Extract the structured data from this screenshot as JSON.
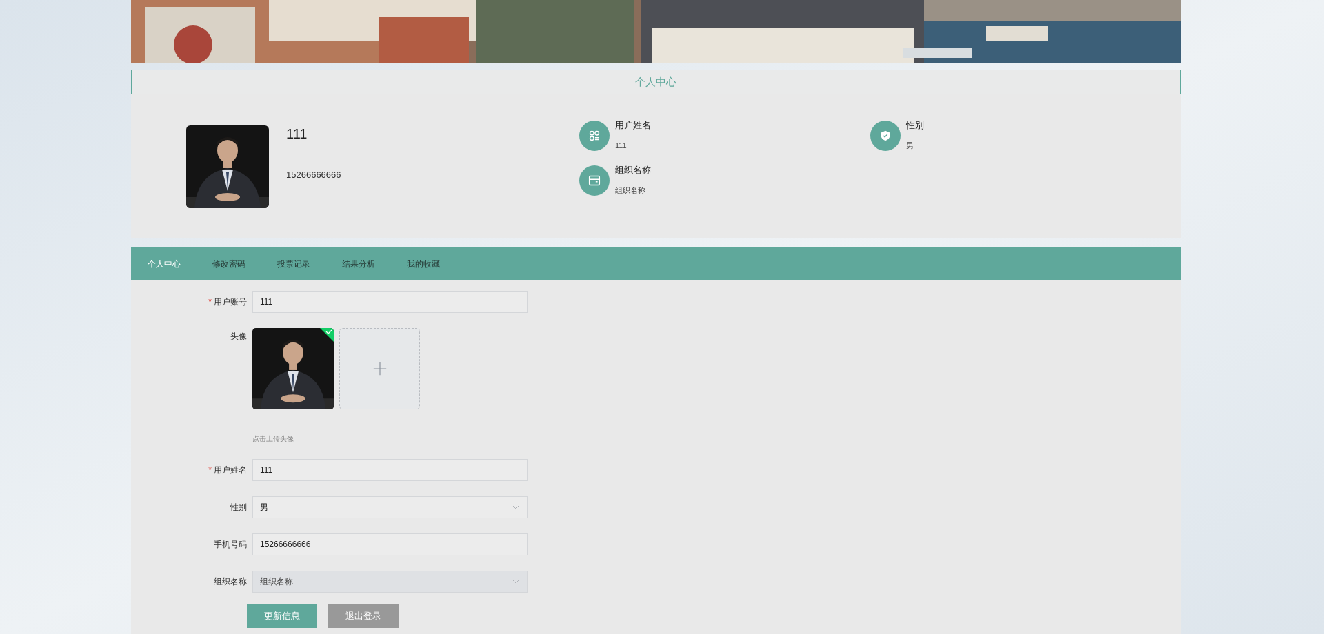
{
  "title": "个人中心",
  "profile": {
    "name": "111",
    "phone": "15266666666",
    "info_columns": [
      [
        {
          "label": "用户姓名",
          "value": "111"
        },
        {
          "label": "组织名称",
          "value": "组织名称"
        }
      ],
      [
        {
          "label": "性别",
          "value": "男"
        }
      ]
    ]
  },
  "tabs": [
    {
      "label": "个人中心",
      "selected": true
    },
    {
      "label": "修改密码",
      "selected": false
    },
    {
      "label": "投票记录",
      "selected": false
    },
    {
      "label": "结果分析",
      "selected": false
    },
    {
      "label": "我的收藏",
      "selected": false
    }
  ],
  "form": {
    "fields": [
      {
        "kind": "text",
        "required_mark": "*",
        "label": "用户账号",
        "value": "111"
      },
      {
        "kind": "avatar",
        "label": "头像",
        "uploaded": true,
        "hint": "点击上传头像"
      },
      {
        "kind": "text",
        "required_mark": "*",
        "label": "用户姓名",
        "value": "111"
      },
      {
        "kind": "select",
        "label": "性别",
        "value": "男",
        "disabled": false
      },
      {
        "kind": "text",
        "label": "手机号码",
        "value": "15266666666"
      },
      {
        "kind": "select",
        "label": "组织名称",
        "value": "组织名称",
        "disabled": true
      }
    ],
    "buttons": [
      {
        "kind": "primary",
        "label": "更新信息"
      },
      {
        "kind": "secondary",
        "label": "退出登录"
      }
    ]
  }
}
